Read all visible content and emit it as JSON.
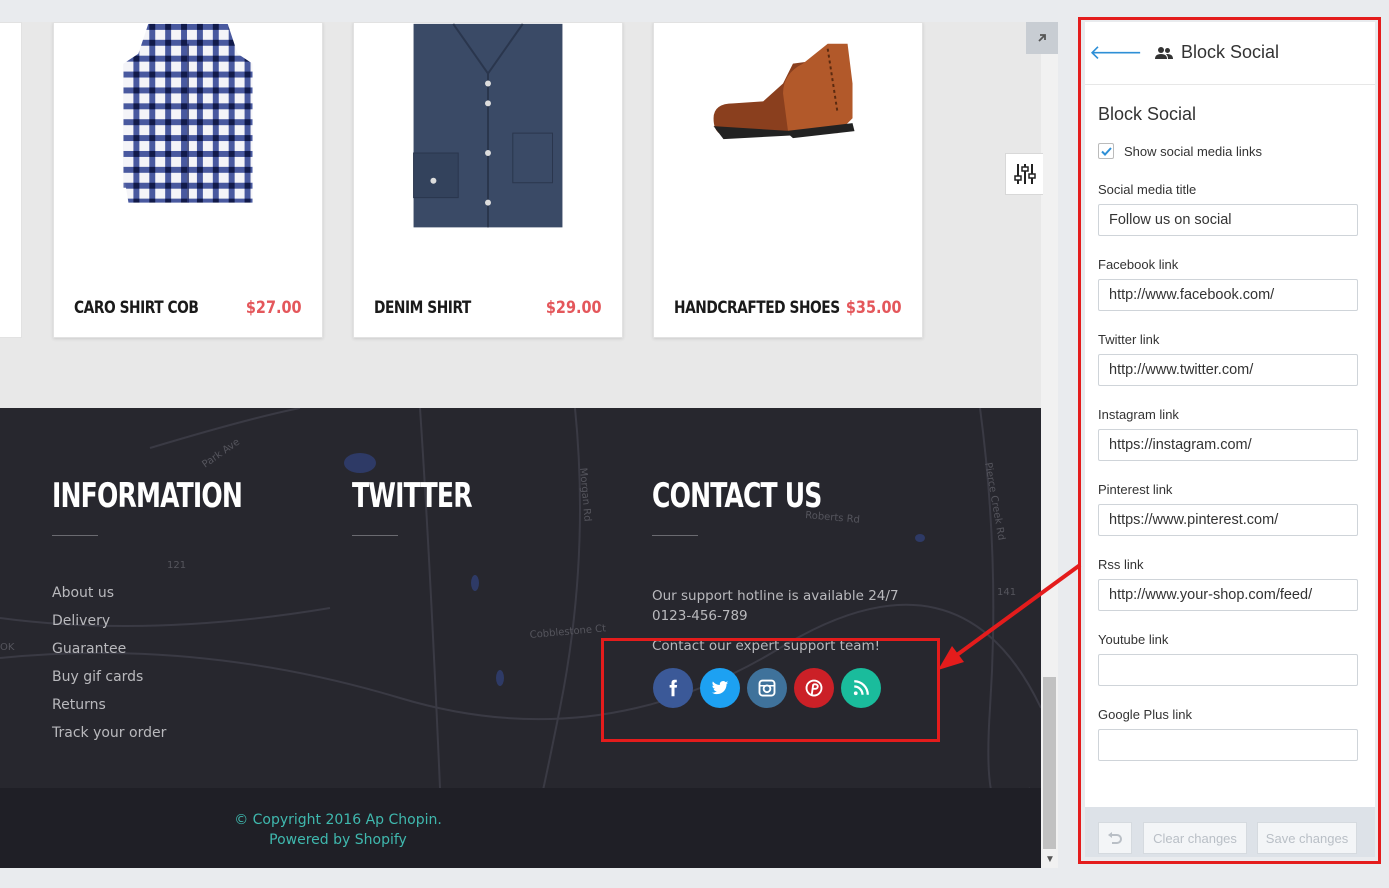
{
  "products": [
    {
      "name": "CARO SHIRT COB",
      "price": "$27.00"
    },
    {
      "name": "DENIM SHIRT",
      "price": "$29.00"
    },
    {
      "name": "HANDCRAFTED SHOES",
      "price": "$35.00"
    }
  ],
  "footer": {
    "information": {
      "title": "INFORMATION",
      "links": [
        "About us",
        "Delivery",
        "Guarantee",
        "Buy gif cards",
        "Returns",
        "Track your order"
      ]
    },
    "twitter": {
      "title": "TWITTER"
    },
    "contact": {
      "title": "CONTACT US",
      "hotline": "Our support hotline is available 24/7",
      "phone": "0123-456-789",
      "support": "Contact our expert support team!"
    },
    "social_icons": [
      {
        "icon": "facebook-icon",
        "color": "#3b5998"
      },
      {
        "icon": "twitter-icon",
        "color": "#1da1f2"
      },
      {
        "icon": "instagram-icon",
        "color": "#3f729b"
      },
      {
        "icon": "pinterest-icon",
        "color": "#cb2027"
      },
      {
        "icon": "rss-icon",
        "color": "#1abc9c"
      }
    ],
    "copyright": "© Copyright 2016 Ap Chopin.",
    "powered": "Powered by Shopify"
  },
  "map_labels": [
    "Park Ave",
    "Morgan Rd",
    "Roberts Rd",
    "Cobblestone Ct",
    "Pierce Creek Rd",
    "121",
    "141",
    "OK"
  ],
  "panel": {
    "header_title": "Block Social",
    "section_title": "Block Social",
    "show_social_label": "Show social media links",
    "show_social_checked": true,
    "fields": [
      {
        "label": "Social media title",
        "value": "Follow us on social"
      },
      {
        "label": "Facebook link",
        "value": "http://www.facebook.com/"
      },
      {
        "label": "Twitter link",
        "value": "http://www.twitter.com/"
      },
      {
        "label": "Instagram link",
        "value": "https://instagram.com/"
      },
      {
        "label": "Pinterest link",
        "value": "https://www.pinterest.com/"
      },
      {
        "label": "Rss link",
        "value": "http://www.your-shop.com/feed/"
      },
      {
        "label": "Youtube link",
        "value": ""
      },
      {
        "label": "Google Plus link",
        "value": ""
      }
    ],
    "clear_label": "Clear changes",
    "save_label": "Save changes"
  },
  "colors": {
    "price": "#e4575b",
    "footer_bg": "#27272e",
    "copyright_text": "#3fb8ae",
    "annotation": "#e41c1c",
    "accent_blue": "#2e8fd6"
  }
}
